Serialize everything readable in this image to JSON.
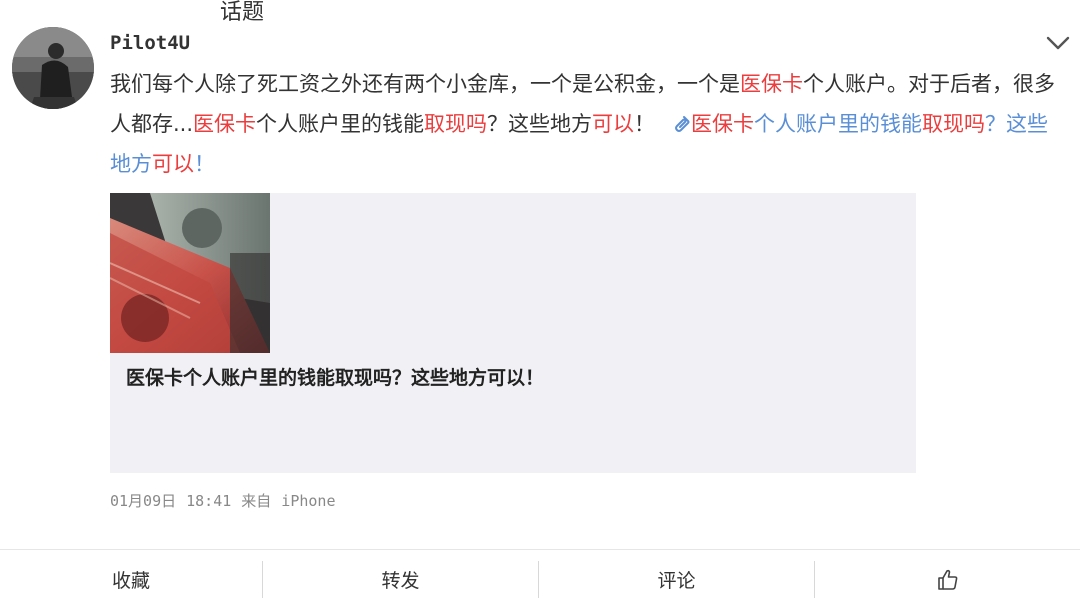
{
  "topic_tag": "话题",
  "post": {
    "username": "Pilot4U",
    "text_segments": [
      {
        "text": "我们每个人除了死工资之外还有两个小金库，一个是公积金，一个是",
        "style": "normal"
      },
      {
        "text": "医保卡",
        "style": "red"
      },
      {
        "text": "个人账户。对于后者，很多人都存...",
        "style": "normal"
      },
      {
        "text": "医保卡",
        "style": "red"
      },
      {
        "text": "个人账户里的钱能",
        "style": "normal"
      },
      {
        "text": "取现吗",
        "style": "red"
      },
      {
        "text": "？这些地方",
        "style": "normal"
      },
      {
        "text": "可以",
        "style": "red"
      },
      {
        "text": "！",
        "style": "normal"
      }
    ],
    "link_segments": [
      {
        "text": "医保卡",
        "style": "red"
      },
      {
        "text": "个人账户里的钱能",
        "style": "blue"
      },
      {
        "text": "取现吗",
        "style": "red"
      },
      {
        "text": "？这些地方",
        "style": "blue"
      },
      {
        "text": "可以",
        "style": "red"
      },
      {
        "text": "！",
        "style": "blue"
      }
    ],
    "card_title": "医保卡个人账户里的钱能取现吗？这些地方可以！",
    "date": "01月09日",
    "time": "18:41",
    "source_prefix": "来自",
    "source": "iPhone"
  },
  "actions": {
    "favorite": "收藏",
    "repost": "转发",
    "comment": "评论"
  },
  "icons": {
    "more": "chevron-down-icon",
    "link": "link-icon",
    "like": "thumbs-up-icon"
  },
  "colors": {
    "keyword_red": "#eb3d3d",
    "link_blue": "#5a8fd6",
    "card_background": "#f1f1f5"
  }
}
